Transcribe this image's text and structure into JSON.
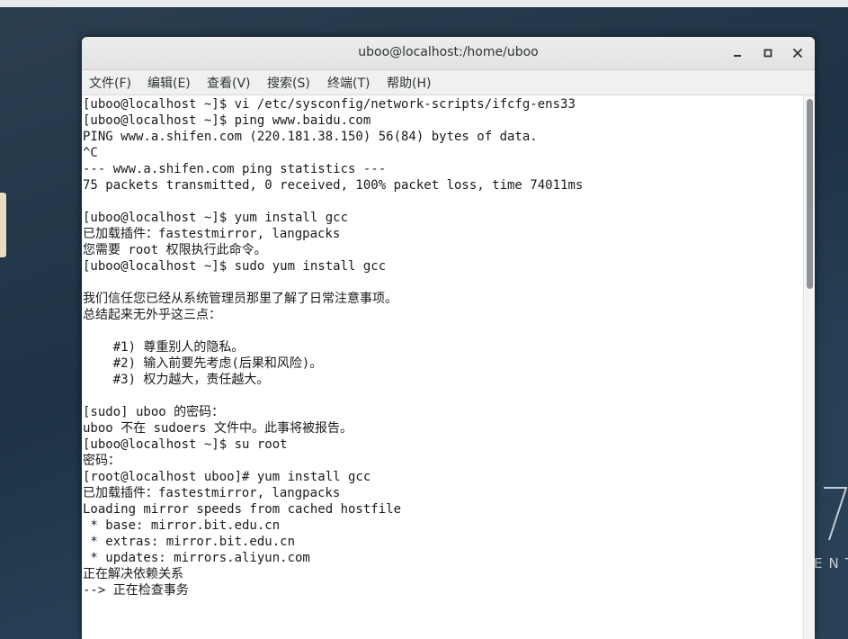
{
  "window": {
    "title": "uboo@localhost:/home/uboo"
  },
  "menu": {
    "items": [
      "文件(F)",
      "编辑(E)",
      "查看(V)",
      "搜索(S)",
      "终端(T)",
      "帮助(H)"
    ]
  },
  "terminal": {
    "lines": [
      "[uboo@localhost ~]$ vi /etc/sysconfig/network-scripts/ifcfg-ens33",
      "[uboo@localhost ~]$ ping www.baidu.com",
      "PING www.a.shifen.com (220.181.38.150) 56(84) bytes of data.",
      "^C",
      "--- www.a.shifen.com ping statistics ---",
      "75 packets transmitted, 0 received, 100% packet loss, time 74011ms",
      "",
      "[uboo@localhost ~]$ yum install gcc",
      "已加载插件：fastestmirror, langpacks",
      "您需要 root 权限执行此命令。",
      "[uboo@localhost ~]$ sudo yum install gcc",
      "",
      "我们信任您已经从系统管理员那里了解了日常注意事项。",
      "总结起来无外乎这三点：",
      "",
      "    #1) 尊重别人的隐私。",
      "    #2) 输入前要先考虑(后果和风险)。",
      "    #3) 权力越大，责任越大。",
      "",
      "[sudo] uboo 的密码：",
      "uboo 不在 sudoers 文件中。此事将被报告。",
      "[uboo@localhost ~]$ su root",
      "密码：",
      "[root@localhost uboo]# yum install gcc",
      "已加载插件：fastestmirror, langpacks",
      "Loading mirror speeds from cached hostfile",
      " * base: mirror.bit.edu.cn",
      " * extras: mirror.bit.edu.cn",
      " * updates: mirrors.aliyun.com",
      "正在解决依赖关系",
      "--> 正在检查事务"
    ]
  },
  "desktop": {
    "logo_text": "ENT"
  },
  "icons": {
    "minimize": "minimize-icon",
    "maximize": "maximize-icon",
    "close": "close-icon"
  }
}
